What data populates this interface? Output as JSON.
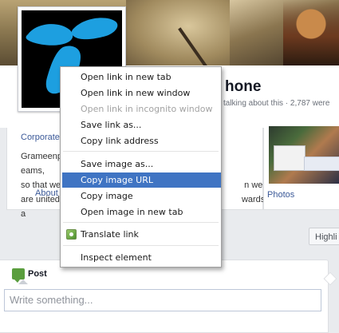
{
  "page": {
    "name": "hone",
    "talking": "talking about this · 2,787 were",
    "category": "Corporate",
    "description": "Grameenp                                          eams,\nso that we                                          n we\nare united                                          wards a",
    "about_tab": "About",
    "photos_tab": "Photos",
    "highlights": "Highli"
  },
  "composer": {
    "post_tab": "Post",
    "placeholder": "Write something..."
  },
  "context_menu": {
    "items": [
      {
        "label": "Open link in new tab"
      },
      {
        "label": "Open link in new window"
      },
      {
        "label": "Open link in incognito window"
      },
      {
        "label": "Save link as..."
      },
      {
        "label": "Copy link address"
      },
      {
        "label": "Save image as..."
      },
      {
        "label": "Copy image URL"
      },
      {
        "label": "Copy image"
      },
      {
        "label": "Open image in new tab"
      },
      {
        "label": "Translate link"
      },
      {
        "label": "Inspect element"
      }
    ],
    "highlighted": "Copy image URL",
    "disabled": "Open link in incognito window"
  },
  "colors": {
    "link": "#3b5998",
    "highlight": "#3f74c3",
    "logo": "#1d9fe0"
  }
}
